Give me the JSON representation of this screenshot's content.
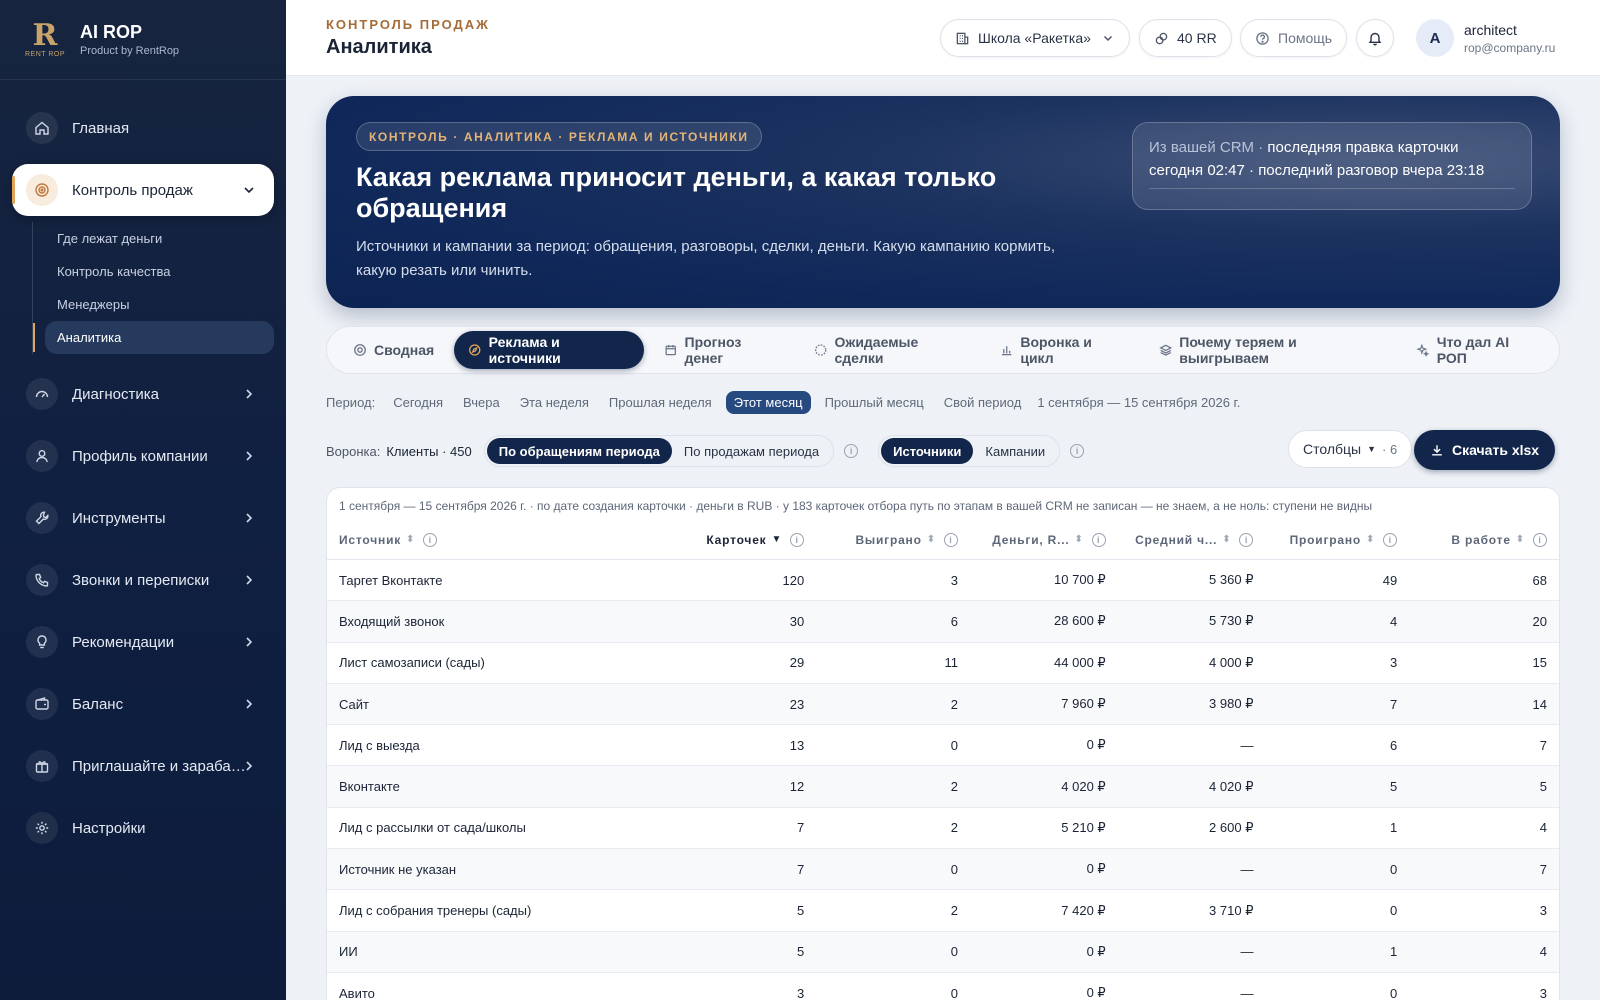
{
  "brand": {
    "logo_glyph": "R",
    "logo_sub": "RENT ROP",
    "name": "AI ROP",
    "subtitle": "Product by RentRop"
  },
  "sidebar": {
    "items": [
      {
        "label": "Главная",
        "icon": "home-icon"
      },
      {
        "label": "Контроль продаж",
        "icon": "target-icon",
        "active": true,
        "expanded": true,
        "children": [
          {
            "label": "Где лежат деньги"
          },
          {
            "label": "Контроль качества"
          },
          {
            "label": "Менеджеры"
          },
          {
            "label": "Аналитика",
            "active": true
          }
        ]
      },
      {
        "label": "Диагностика",
        "icon": "gauge-icon"
      },
      {
        "label": "Профиль компании",
        "icon": "user-icon"
      },
      {
        "label": "Инструменты",
        "icon": "wrench-icon"
      },
      {
        "label": "Звонки и переписки",
        "icon": "phone-icon"
      },
      {
        "label": "Рекомендации",
        "icon": "bulb-icon"
      },
      {
        "label": "Баланс",
        "icon": "wallet-icon"
      },
      {
        "label": "Приглашайте и зараба…",
        "icon": "gift-icon"
      },
      {
        "label": "Настройки",
        "icon": "gear-icon"
      }
    ]
  },
  "header": {
    "kicker": "КОНТРОЛЬ ПРОДАЖ",
    "title": "Аналитика",
    "company": "Школа «Ракетка»",
    "balance": "40 RR",
    "help": "Помощь",
    "avatar_letter": "A",
    "user_name": "architect",
    "user_email": "rop@company.ru"
  },
  "hero": {
    "chip": "КОНТРОЛЬ · АНАЛИТИКА · РЕКЛАМА И ИСТОЧНИКИ",
    "title": "Какая реклама приносит деньги, а какая только обращения",
    "description": "Источники и кампании за период: обращения, разговоры, сделки, деньги. Какую кампанию кормить, какую резать или чинить.",
    "crm_prefix": "Из вашей CRM ·",
    "crm_text": "последняя правка карточки сегодня 02:47 · последний разговор вчера 23:18"
  },
  "tabs": [
    {
      "label": "Сводная",
      "icon": "target-icon"
    },
    {
      "label": "Реклама и источники",
      "icon": "compass-icon",
      "active": true
    },
    {
      "label": "Прогноз денег",
      "icon": "calendar-icon"
    },
    {
      "label": "Ожидаемые сделки",
      "icon": "dial-icon"
    },
    {
      "label": "Воронка и цикл",
      "icon": "bar-chart-icon"
    },
    {
      "label": "Почему теряем и выигрываем",
      "icon": "layers-icon"
    },
    {
      "label": "Что дал AI РОП",
      "icon": "sparkle-icon"
    }
  ],
  "period": {
    "label": "Период:",
    "options": [
      "Сегодня",
      "Вчера",
      "Эта неделя",
      "Прошлая неделя",
      "Этот месяц",
      "Прошлый месяц",
      "Свой период"
    ],
    "selected": "Этот месяц",
    "range": "1 сентября — 15 сентября 2026 г."
  },
  "funnel": {
    "label": "Воронка:",
    "value": "Клиенты · 450",
    "mode_options": [
      "По обращениям периода",
      "По продажам периода"
    ],
    "mode_selected": "По обращениям периода",
    "group_options": [
      "Источники",
      "Кампании"
    ],
    "group_selected": "Источники"
  },
  "columns_button": {
    "label": "Столбцы",
    "count": "· 6"
  },
  "download_button": {
    "label": "Скачать xlsx"
  },
  "table": {
    "note": "1 сентября — 15 сентября 2026 г. · по дате создания карточки · деньги в RUB · у 183 карточек отбора путь по этапам в вашей CRM не записан — не знаем, а не ноль: ступени не видны",
    "columns": [
      "Источник",
      "Карточек",
      "Выиграно",
      "Деньги, R...",
      "Средний ч...",
      "Проиграно",
      "В работе"
    ],
    "sorted_column": "Карточек",
    "rows": [
      [
        "Таргет Вконтакте",
        "120",
        "3",
        "10 700 ₽",
        "5 360 ₽",
        "49",
        "68"
      ],
      [
        "Входящий звонок",
        "30",
        "6",
        "28 600 ₽",
        "5 730 ₽",
        "4",
        "20"
      ],
      [
        "Лист самозаписи (сады)",
        "29",
        "11",
        "44 000 ₽",
        "4 000 ₽",
        "3",
        "15"
      ],
      [
        "Сайт",
        "23",
        "2",
        "7 960 ₽",
        "3 980 ₽",
        "7",
        "14"
      ],
      [
        "Лид с выезда",
        "13",
        "0",
        "0 ₽",
        "—",
        "6",
        "7"
      ],
      [
        "Вконтакте",
        "12",
        "2",
        "4 020 ₽",
        "4 020 ₽",
        "5",
        "5"
      ],
      [
        "Лид с рассылки от сада/школы",
        "7",
        "2",
        "5 210 ₽",
        "2 600 ₽",
        "1",
        "4"
      ],
      [
        "Источник не указан",
        "7",
        "0",
        "0 ₽",
        "—",
        "0",
        "7"
      ],
      [
        "Лид с собрания тренеры (сады)",
        "5",
        "2",
        "7 420 ₽",
        "3 710 ₽",
        "0",
        "3"
      ],
      [
        "ИИ",
        "5",
        "0",
        "0 ₽",
        "—",
        "1",
        "4"
      ],
      [
        "Авито",
        "3",
        "0",
        "0 ₽",
        "—",
        "0",
        "3"
      ]
    ]
  },
  "colors": {
    "accent": "#e0a45a",
    "navy": "#12264b",
    "sidebar": "#0f1f40"
  }
}
